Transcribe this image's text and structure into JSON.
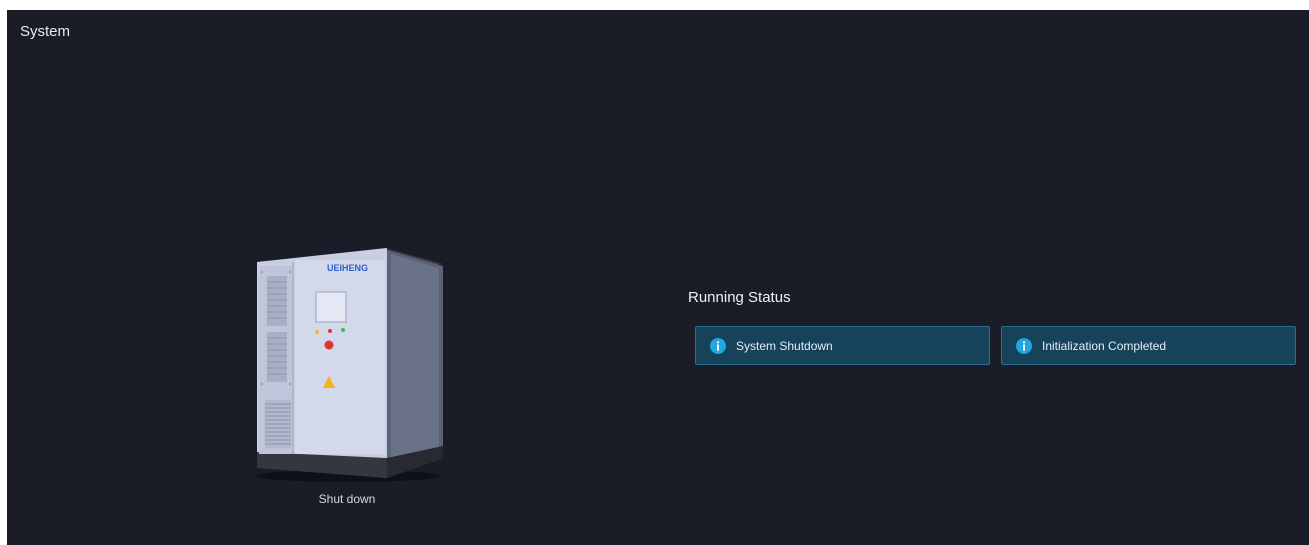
{
  "panel": {
    "title": "System"
  },
  "device": {
    "brand_logo": "WEIHENG",
    "state_label": "Shut down"
  },
  "running_status": {
    "title": "Running Status",
    "items": [
      {
        "icon": "info-icon",
        "label": "System Shutdown"
      },
      {
        "icon": "info-icon",
        "label": "Initialization Completed"
      }
    ]
  },
  "colors": {
    "panel_background": "#1a1d27",
    "status_card_background": "#16425a",
    "info_icon": "#1fa7de",
    "warning_triangle": "#f3b414",
    "indicator_red": "#e53030",
    "indicator_green": "#36c24c"
  }
}
